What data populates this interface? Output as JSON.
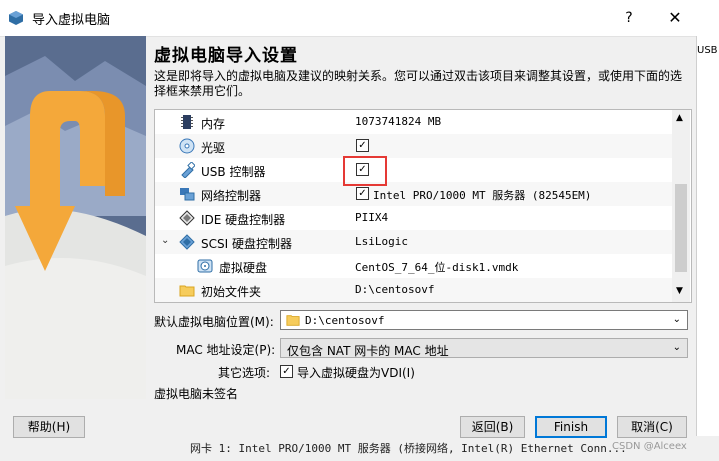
{
  "window": {
    "title": "导入虚拟电脑",
    "help": "?",
    "close": "✕",
    "edge_text": "USB"
  },
  "header": {
    "title": "虚拟电脑导入设置",
    "description": "这是即将导入的虚拟电脑及建议的映射关系。您可以通过双击该项目来调整其设置，或使用下面的选择框来禁用它们。"
  },
  "tree": {
    "rows": [
      {
        "icon": "memory-icon",
        "label": "内存",
        "value": "1073741824 MB",
        "checked": null
      },
      {
        "icon": "optical-drive-icon",
        "label": "光驱",
        "value": "",
        "checked": true
      },
      {
        "icon": "usb-icon",
        "label": "USB 控制器",
        "value": "",
        "checked": true
      },
      {
        "icon": "network-icon",
        "label": "网络控制器",
        "value": "Intel PRO/1000 MT 服务器 (82545EM)",
        "checked": true
      },
      {
        "icon": "ide-controller-icon",
        "label": "IDE 硬盘控制器",
        "value": "PIIX4",
        "checked": null
      },
      {
        "icon": "scsi-controller-icon",
        "label": "SCSI 硬盘控制器",
        "value": "LsiLogic",
        "checked": null
      },
      {
        "icon": "virtual-disk-icon",
        "label": "虚拟硬盘",
        "value": "CentOS_7_64_位-disk1.vmdk",
        "checked": null
      },
      {
        "icon": "folder-icon",
        "label": "初始文件夹",
        "value": "D:\\centosovf",
        "checked": null
      }
    ]
  },
  "form": {
    "location_label": "默认虚拟电脑位置(M):",
    "location_value": "D:\\centosovf",
    "mac_label": "MAC 地址设定(P):",
    "mac_value": "仅包含 NAT 网卡的 MAC 地址",
    "other_label": "其它选项:",
    "other_checkbox_label": "导入虚拟硬盘为VDI(I)",
    "other_checked": true,
    "unsigned_note": "虚拟电脑未签名"
  },
  "buttons": {
    "help": "帮助(H)",
    "back": "返回(B)",
    "finish": "Finish",
    "cancel": "取消(C)"
  },
  "status_bar": "网卡 1:  Intel PRO/1000 MT 服务器 (桥接网络, Intel(R) Ethernet Conn...",
  "watermark": "CSDN @Alceex",
  "colors": {
    "highlight": "#e53935",
    "accent": "#0078d7",
    "arrow_orange": "#f4a83a"
  }
}
